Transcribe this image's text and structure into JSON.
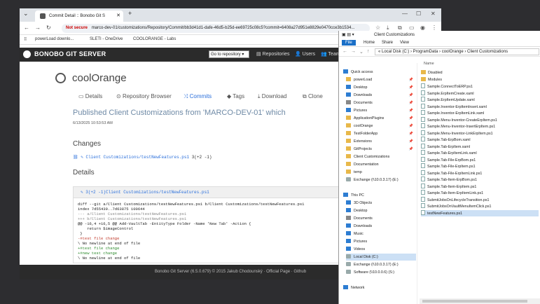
{
  "browser": {
    "tab_title": "Commit Detail :: Bonobo Git S",
    "new_tab": "+",
    "url_not_secure": "Not secure",
    "url": "marco-dev-01/customizations/Repository/Commit/bb3d41d1-dafe-46d5-b25d-ee69725c08c5?commit=6408a27d951e8829e0470cce3b1534...",
    "bookmarks": [
      "powerLoad downlo...",
      "SLETI - OneDrive",
      "COOLORANGE - Labs"
    ]
  },
  "bonobo": {
    "brand": "BONOBO GIT SERVER",
    "repo_select": "Go to repository",
    "nav": [
      "Repositories",
      "Users",
      "Team"
    ],
    "repo_name": "coolOrange",
    "tabs": [
      "Details",
      "Repository Browser",
      "Commits",
      "Tags",
      "Download",
      "Clone"
    ],
    "commit_title": "Published Client Customizations from 'MARCO-DEV-01' which",
    "commit_date": "6/13/2025 10:53:53 AM",
    "changes_heading": "Changes",
    "change_file": "Client Customizations/testNewFeatures.ps1",
    "change_counts": "3(+2 -1)",
    "details_heading": "Details",
    "diff_header": "3(+2 -1)Client Customizations/testNewFeatures.ps1",
    "diff_lines": [
      {
        "t": "diff --git a/Client Customizations/testNewFeatures.ps1 b/Client Customizations/testNewFeatures.ps1",
        "k": ""
      },
      {
        "t": "index 7d55439..7d63875 100644",
        "k": ""
      },
      {
        "t": "--- a/Client Customizations/testNewFeatures.ps1",
        "k": "meta"
      },
      {
        "t": "+++ b/Client Customizations/testNewFeatures.ps1",
        "k": "meta"
      },
      {
        "t": "@@ -16,4 +16,5 @@ Add-VaultTab -EntityType Folder -Name 'New Tab' -Action {",
        "k": ""
      },
      {
        "t": "    return $imageControl",
        "k": ""
      },
      {
        "t": " }",
        "k": ""
      },
      {
        "t": "",
        "k": ""
      },
      {
        "t": "-#test file change",
        "k": "del"
      },
      {
        "t": "\\ No newline at end of file",
        "k": ""
      },
      {
        "t": "+#test file change",
        "k": "add"
      },
      {
        "t": "+#new test change",
        "k": "add"
      },
      {
        "t": "\\ No newline at end of file",
        "k": ""
      }
    ],
    "footer": "Bonobo Git Server (6.5.0.679) © 2015 Jakub Chodounský · Official Page · Github"
  },
  "explorer": {
    "title": "Client Customizations",
    "ribbon": [
      "File",
      "Home",
      "Share",
      "View"
    ],
    "path": "« Local Disk (C:) › ProgramData › coolOrange › Client Customizations",
    "col_name": "Name",
    "nav": [
      {
        "label": "Quick access",
        "icon": "blue",
        "indent": 0
      },
      {
        "label": "powerLoad",
        "icon": "fold",
        "indent": 1,
        "pin": true
      },
      {
        "label": "Desktop",
        "icon": "blue",
        "indent": 1,
        "pin": true
      },
      {
        "label": "Downloads",
        "icon": "blue",
        "indent": 1,
        "pin": true
      },
      {
        "label": "Documents",
        "icon": "grey",
        "indent": 1,
        "pin": true
      },
      {
        "label": "Pictures",
        "icon": "blue",
        "indent": 1,
        "pin": true
      },
      {
        "label": "ApplicationPlugins",
        "icon": "fold",
        "indent": 1,
        "pin": true
      },
      {
        "label": "coolOrange",
        "icon": "fold",
        "indent": 1,
        "pin": true
      },
      {
        "label": "TestFolderApp",
        "icon": "fold",
        "indent": 1,
        "pin": true
      },
      {
        "label": "Extensions",
        "icon": "fold",
        "indent": 1,
        "pin": true
      },
      {
        "label": "GitProjects",
        "icon": "fold",
        "indent": 1,
        "pin": true
      },
      {
        "label": "Client Customizations",
        "icon": "fold",
        "indent": 1
      },
      {
        "label": "Documentation",
        "icon": "fold",
        "indent": 1
      },
      {
        "label": "temp",
        "icon": "fold",
        "indent": 1
      },
      {
        "label": "Exchange (\\\\10.0.3.17) (E:)",
        "icon": "drive",
        "indent": 1
      },
      {
        "label": "",
        "icon": "",
        "indent": 1
      },
      {
        "label": "This PC",
        "icon": "blue",
        "indent": 0
      },
      {
        "label": "3D Objects",
        "icon": "blue",
        "indent": 1
      },
      {
        "label": "Desktop",
        "icon": "blue",
        "indent": 1
      },
      {
        "label": "Documents",
        "icon": "grey",
        "indent": 1
      },
      {
        "label": "Downloads",
        "icon": "blue",
        "indent": 1
      },
      {
        "label": "Music",
        "icon": "blue",
        "indent": 1
      },
      {
        "label": "Pictures",
        "icon": "blue",
        "indent": 1
      },
      {
        "label": "Videos",
        "icon": "blue",
        "indent": 1
      },
      {
        "label": "Local Disk (C:)",
        "icon": "drive",
        "indent": 1,
        "selected": true
      },
      {
        "label": "Exchange (\\\\10.0.3.17) (E:)",
        "icon": "drive",
        "indent": 1
      },
      {
        "label": "Software (\\\\10.0.0.6) (S:)",
        "icon": "drive",
        "indent": 1
      },
      {
        "label": "",
        "icon": "",
        "indent": 1
      },
      {
        "label": "Network",
        "icon": "blue",
        "indent": 0
      }
    ],
    "files": [
      {
        "name": "Disabled",
        "folder": true
      },
      {
        "name": "Modules",
        "folder": true
      },
      {
        "name": "Sample.ConnectToERP.ps1"
      },
      {
        "name": "Sample.ErpItemCreate.xaml"
      },
      {
        "name": "Sample.ErpItemUpdate.xaml"
      },
      {
        "name": "Sample.Inventor-ErpItemInsert.xaml"
      },
      {
        "name": "Sample.Inventor-ErpItemLink.xaml"
      },
      {
        "name": "Sample.Menu-Inventor-CreateErpItem.ps1"
      },
      {
        "name": "Sample.Menu-Inventor-InsertErpItem.ps1"
      },
      {
        "name": "Sample.Menu-Inventor-LinkErpItem.ps1"
      },
      {
        "name": "Sample.Tab-ErpBom.xaml"
      },
      {
        "name": "Sample.Tab-ErpItem.xaml"
      },
      {
        "name": "Sample.Tab-ErpItemLink.xaml"
      },
      {
        "name": "Sample.Tab-File-ErpBom.ps1"
      },
      {
        "name": "Sample.Tab-File-ErpItem.ps1"
      },
      {
        "name": "Sample.Tab-File-ErpItemLink.ps1"
      },
      {
        "name": "Sample.Tab-Item-ErpBom.ps1"
      },
      {
        "name": "Sample.Tab-Item-ErpItem.ps1"
      },
      {
        "name": "Sample.Tab-Item-ErpItemLink.ps1"
      },
      {
        "name": "SubmitJobsOnLifecycleTransition.ps1"
      },
      {
        "name": "SubmitJobsOnVaultMenuItemClick.ps1"
      },
      {
        "name": "testNewFeatures.ps1",
        "selected": true
      }
    ]
  },
  "colors": {
    "accent": "#2a6fdb",
    "nav_dark": "#2b2b2b",
    "commit_title": "#6f8aa6"
  }
}
